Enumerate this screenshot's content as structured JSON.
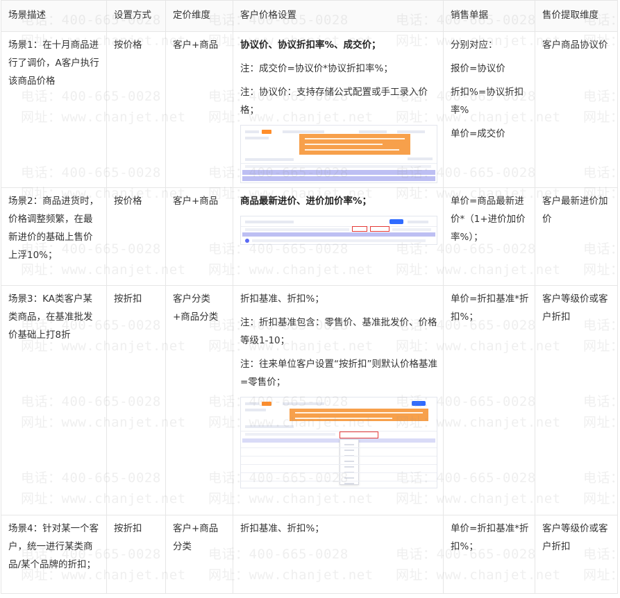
{
  "table": {
    "headers": [
      "场景描述",
      "设置方式",
      "定价维度",
      "客户价格设置",
      "销售单据",
      "售价提取维度"
    ],
    "rows": [
      {
        "scene": "场景1：在十月商品进行了调价，A客户执行该商品价格",
        "method": "按价格",
        "dimension": "客户+商品",
        "price": [
          "协议价、协议折扣率%、成交价；",
          "注：成交价=协议价*协议折扣率%；",
          "注：协议价：支持存储公式配置或手工录入价格；"
        ],
        "sales": [
          "分别对应：",
          "报价=协议价",
          "折扣%=协议折扣率%",
          "单价=成交价"
        ],
        "extract": "客户商品协议价"
      },
      {
        "scene": "场景2：商品进货时，价格调整频繁，在最新进价的基础上售价上浮10%；",
        "method": "按价格",
        "dimension": "客户+商品",
        "price": [
          "商品最新进价、进价加价率%；"
        ],
        "sales": [
          "单价=商品最新进价*（1+进价加价率%）；"
        ],
        "extract": "客户最新进价加价"
      },
      {
        "scene": "场景3：KA类客户某类商品，在基准批发价基础上打8折",
        "method": "按折扣",
        "dimension": "客户分类+商品分类",
        "price": [
          "折扣基准、折扣%；",
          "注：折扣基准包含：零售价、基准批发价、价格等级1-10；",
          "注：往来单位客户设置“按折扣”则默认价格基准=零售价；"
        ],
        "sales": [
          "单价=折扣基准*折扣%；"
        ],
        "extract": "客户等级价或客户折扣"
      },
      {
        "scene": "场景4：针对某一个客户，统一进行某类商品/某个品牌的折扣；",
        "method": "按折扣",
        "dimension": "客户+商品分类",
        "price": [
          "折扣基准、折扣%；"
        ],
        "sales": [
          "单价=折扣基准*折扣%；"
        ],
        "extract": "客户等级价或客户折扣"
      }
    ]
  },
  "watermark": {
    "phone": "电话：400-665-0028",
    "site": "网址：www.chanjet.net"
  }
}
